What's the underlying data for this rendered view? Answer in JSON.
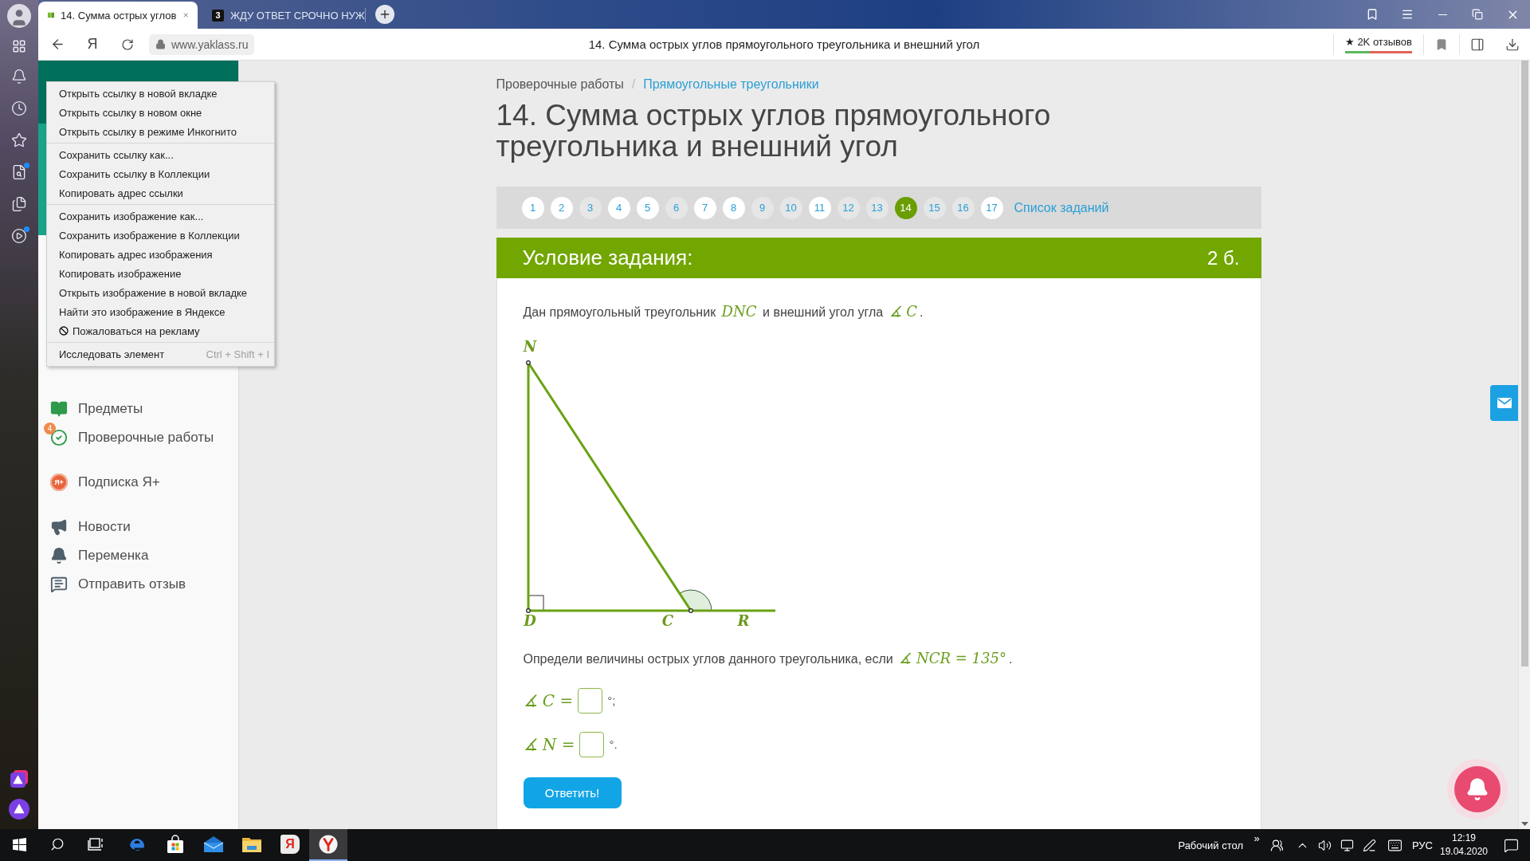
{
  "browser": {
    "tabs": [
      {
        "title": "14. Сумма острых углов",
        "selected": true
      },
      {
        "title": "ЖДУ ОТВЕТ СРОЧНО НУЖ",
        "favicon_text": "3",
        "selected": false
      }
    ],
    "home_button": "Я",
    "url": "www.yaklass.ru",
    "page_title": "14. Сумма острых углов прямоугольного треугольника и внешний угол",
    "reviews": {
      "label": "★ 2K отзывов",
      "level": 0.37
    }
  },
  "side_panel": {
    "tools": [
      {
        "unread": false
      },
      {
        "unread": false
      },
      {
        "unread": false
      },
      {
        "unread": true
      },
      {
        "unread": false
      },
      {
        "unread": true
      }
    ]
  },
  "sidebar": {
    "groups": [
      [
        {
          "label": "Предметы"
        },
        {
          "label": "Проверочные работы",
          "badge": "4"
        }
      ],
      [
        {
          "label": "Подписка Я+",
          "icon_text": "Я+"
        }
      ],
      [
        {
          "label": "Новости"
        },
        {
          "label": "Переменка"
        },
        {
          "label": "Отправить отзыв"
        }
      ]
    ]
  },
  "context_menu": {
    "groups": [
      [
        {
          "kind": "plain",
          "label": "Открыть ссылку в новой вкладке"
        },
        {
          "kind": "plain",
          "label": "Открыть ссылку в новом окне"
        },
        {
          "kind": "plain",
          "label": "Открыть ссылку в режиме Инкогнито"
        }
      ],
      [
        {
          "kind": "plain",
          "label": "Сохранить ссылку как..."
        },
        {
          "kind": "plain",
          "label": "Сохранить ссылку в Коллекции"
        },
        {
          "kind": "plain",
          "label": "Копировать адрес ссылки"
        }
      ],
      [
        {
          "kind": "plain",
          "label": "Сохранить изображение как..."
        },
        {
          "kind": "plain",
          "label": "Сохранить изображение в Коллекции"
        },
        {
          "kind": "plain",
          "label": "Копировать адрес изображения"
        },
        {
          "kind": "plain",
          "label": "Копировать изображение"
        },
        {
          "kind": "plain",
          "label": "Открыть изображение в новой вкладке"
        },
        {
          "kind": "plain",
          "label": "Найти это изображение в Яндексе"
        },
        {
          "kind": "report",
          "label": "Пожаловаться на рекламу"
        }
      ],
      [
        {
          "kind": "shortcut",
          "label": "Исследовать элемент",
          "shortcut": "Ctrl + Shift + I"
        }
      ]
    ]
  },
  "breadcrumb": {
    "items": [
      {
        "kind": "text",
        "label": "Проверочные работы"
      },
      {
        "kind": "link",
        "label": "Прямоугольные треугольники"
      }
    ],
    "separator": "/"
  },
  "title": "14. Сумма острых углов прямоугольного треугольника и внешний угол",
  "pagination": {
    "pages": [
      {
        "label": "1",
        "selected": false,
        "visited": true
      },
      {
        "label": "2",
        "selected": false,
        "visited": true
      },
      {
        "label": "3",
        "selected": false,
        "visited": false
      },
      {
        "label": "4",
        "selected": false,
        "visited": true
      },
      {
        "label": "5",
        "selected": false,
        "visited": true
      },
      {
        "label": "6",
        "selected": false,
        "visited": false
      },
      {
        "label": "7",
        "selected": false,
        "visited": true
      },
      {
        "label": "8",
        "selected": false,
        "visited": true
      },
      {
        "label": "9",
        "selected": false,
        "visited": false
      },
      {
        "label": "10",
        "selected": false,
        "visited": false
      },
      {
        "label": "11",
        "selected": false,
        "visited": true
      },
      {
        "label": "12",
        "selected": false,
        "visited": false
      },
      {
        "label": "13",
        "selected": false,
        "visited": false
      },
      {
        "label": "14",
        "selected": true,
        "visited": false
      },
      {
        "label": "15",
        "selected": false,
        "visited": false
      },
      {
        "label": "16",
        "selected": false,
        "visited": false
      },
      {
        "label": "17",
        "selected": false,
        "visited": true
      }
    ],
    "list_link": "Список заданий"
  },
  "task": {
    "header": "Условие задания:",
    "points": "2 б.",
    "intro": "Дан прямоугольный треугольник *DNC* и внешний угол угла *∡ C*.",
    "figure": {
      "points": [
        {
          "label": "N"
        },
        {
          "label": "D"
        },
        {
          "label": "C"
        },
        {
          "label": "R"
        }
      ]
    },
    "question": "Определи величины острых углов данного треугольника, если *∡ NCR = 135°*.",
    "answers": [
      {
        "lhs": "∡ C =",
        "suffix": "°;"
      },
      {
        "lhs": "∡ N =",
        "suffix": "°."
      }
    ],
    "submit": "Ответить!"
  },
  "taskbar": {
    "apps": [
      {
        "selected": false
      },
      {
        "selected": false
      },
      {
        "selected": false
      },
      {
        "selected": false
      },
      {
        "selected": false,
        "glyph": "Я"
      },
      {
        "selected": true
      }
    ],
    "desktop_label": "Рабочий стол",
    "overflow": "»",
    "language": "РУС",
    "time": "12:19",
    "date": "19.04.2020"
  }
}
